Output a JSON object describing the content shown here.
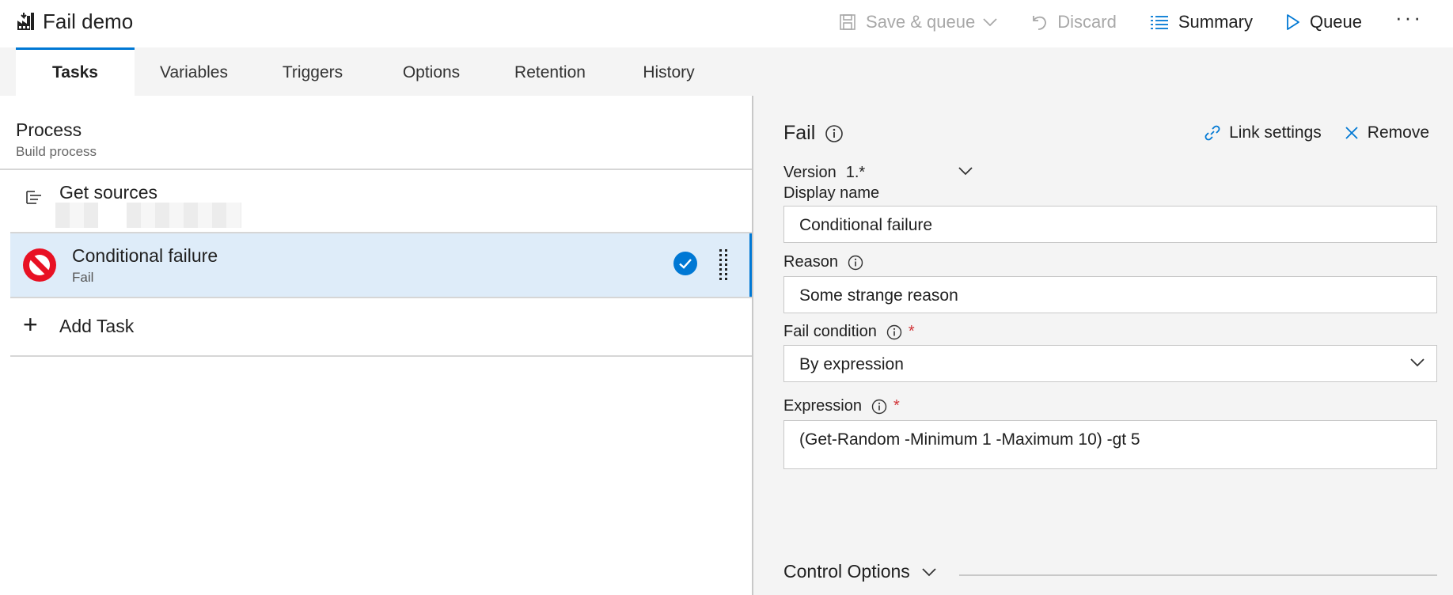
{
  "header": {
    "title": "Fail demo",
    "toolbar": {
      "save_queue": "Save & queue",
      "discard": "Discard",
      "summary": "Summary",
      "queue": "Queue",
      "more": "···"
    }
  },
  "tabs": [
    {
      "label": "Tasks",
      "active": true
    },
    {
      "label": "Variables"
    },
    {
      "label": "Triggers"
    },
    {
      "label": "Options"
    },
    {
      "label": "Retention"
    },
    {
      "label": "History"
    }
  ],
  "process": {
    "title": "Process",
    "subtitle": "Build process",
    "get_sources": "Get sources",
    "tasks": [
      {
        "name": "Conditional failure",
        "type": "Fail",
        "selected": true
      }
    ],
    "add_task": "Add Task"
  },
  "detail": {
    "title": "Fail",
    "link_settings": "Link settings",
    "remove": "Remove",
    "version_label": "Version",
    "version_value": "1.*",
    "display_name_label": "Display name",
    "display_name_value": "Conditional failure",
    "reason_label": "Reason",
    "reason_value": "Some strange reason",
    "fail_condition_label": "Fail condition",
    "fail_condition_value": "By expression",
    "expression_label": "Expression",
    "expression_value": "(Get-Random -Minimum 1 -Maximum 10) -gt 5",
    "required_mark": "*",
    "control_options": "Control Options"
  },
  "colors": {
    "accent": "#0078d4",
    "selected_row": "#deecf9",
    "error": "#d13438",
    "tab_bg": "#f4f4f4"
  }
}
